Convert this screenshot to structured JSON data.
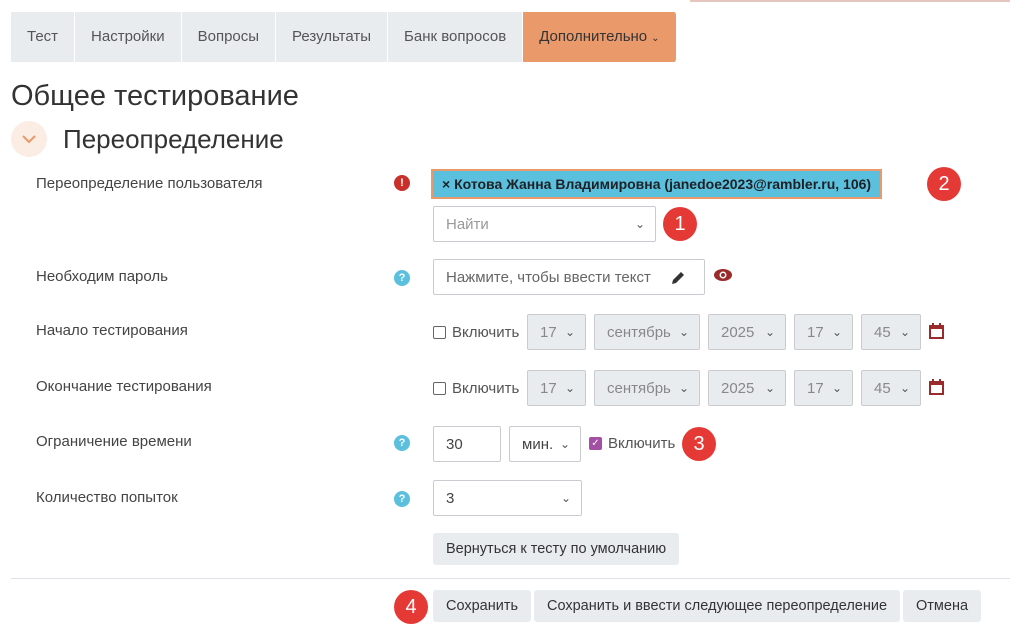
{
  "tabs": [
    {
      "label": "Тест"
    },
    {
      "label": "Настройки"
    },
    {
      "label": "Вопросы"
    },
    {
      "label": "Результаты"
    },
    {
      "label": "Банк вопросов"
    },
    {
      "label": "Дополнительно",
      "active": true
    }
  ],
  "page_title": "Общее тестирование",
  "section_title": "Переопределение",
  "fields": {
    "user_override": {
      "label": "Переопределение пользователя",
      "selected_user": "× Котова Жанна Владимировна (janedoe2023@rambler.ru, 106)",
      "search_placeholder": "Найти"
    },
    "password": {
      "label": "Необходим пароль",
      "placeholder": "Нажмите, чтобы ввести текст"
    },
    "start": {
      "label": "Начало тестирования",
      "enable_label": "Включить",
      "enabled": false,
      "day": "17",
      "month": "сентябрь",
      "year": "2025",
      "hour": "17",
      "minute": "45"
    },
    "end": {
      "label": "Окончание тестирования",
      "enable_label": "Включить",
      "enabled": false,
      "day": "17",
      "month": "сентябрь",
      "year": "2025",
      "hour": "17",
      "minute": "45"
    },
    "time_limit": {
      "label": "Ограничение времени",
      "value": "30",
      "unit": "мин.",
      "enable_label": "Включить",
      "enabled": true
    },
    "attempts": {
      "label": "Количество попыток",
      "value": "3"
    }
  },
  "revert_button": "Вернуться к тесту по умолчанию",
  "footer_buttons": {
    "save": "Сохранить",
    "save_next": "Сохранить и ввести следующее переопределение",
    "cancel": "Отмена"
  },
  "annotations": [
    "1",
    "2",
    "3",
    "4"
  ],
  "icons": {
    "error": "!",
    "info": "?"
  },
  "colors": {
    "accent": "#ea996a",
    "info": "#5bc0de",
    "badge": "#e53935",
    "checkbox": "#a34fa3"
  }
}
